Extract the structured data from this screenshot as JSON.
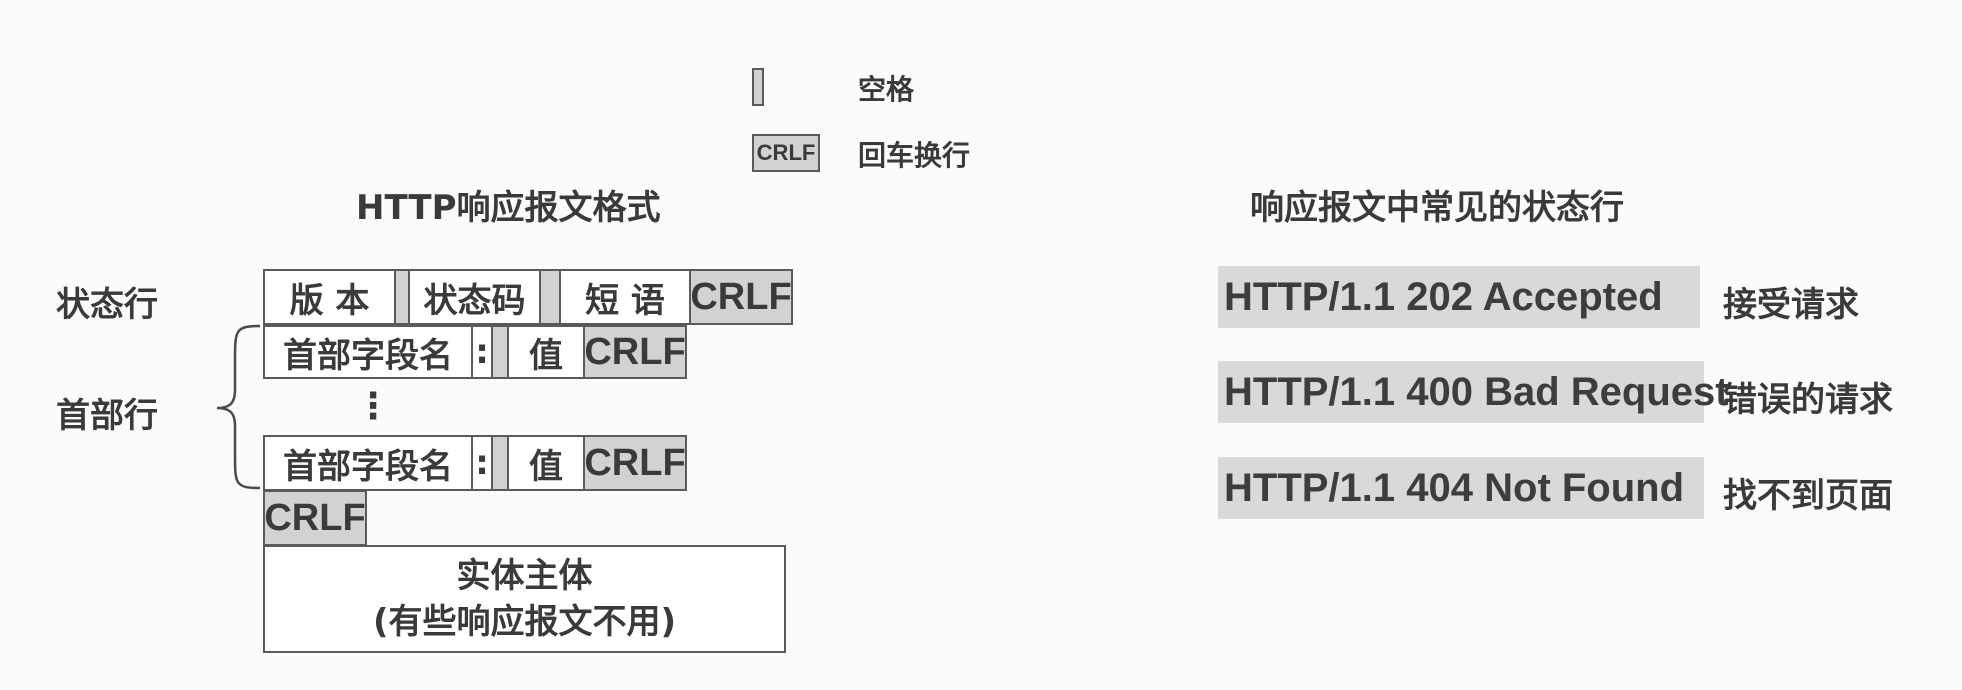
{
  "legend": {
    "space_label": "空格",
    "crlf_box": "CRLF",
    "crlf_label": "回车换行"
  },
  "left": {
    "title": "HTTP响应报文格式",
    "status_line_label": "状态行",
    "header_lines_label": "首部行",
    "status_line": {
      "version": "版 本",
      "status_code": "状态码",
      "phrase": "短 语",
      "crlf": "CRLF"
    },
    "header_row": {
      "field_name": "首部字段名",
      "colon": ":",
      "value": "值",
      "crlf": "CRLF"
    },
    "ellipsis": "⋮",
    "blank_crlf": "CRLF",
    "body_line1": "实体主体",
    "body_line2": "(有些响应报文不用)"
  },
  "right": {
    "title": "响应报文中常见的状态行",
    "items": [
      {
        "status": "HTTP/1.1 202 Accepted",
        "desc": "接受请求"
      },
      {
        "status": "HTTP/1.1 400 Bad Request",
        "desc": "错误的请求"
      },
      {
        "status": "HTTP/1.1 404 Not Found",
        "desc": "找不到页面"
      }
    ]
  }
}
